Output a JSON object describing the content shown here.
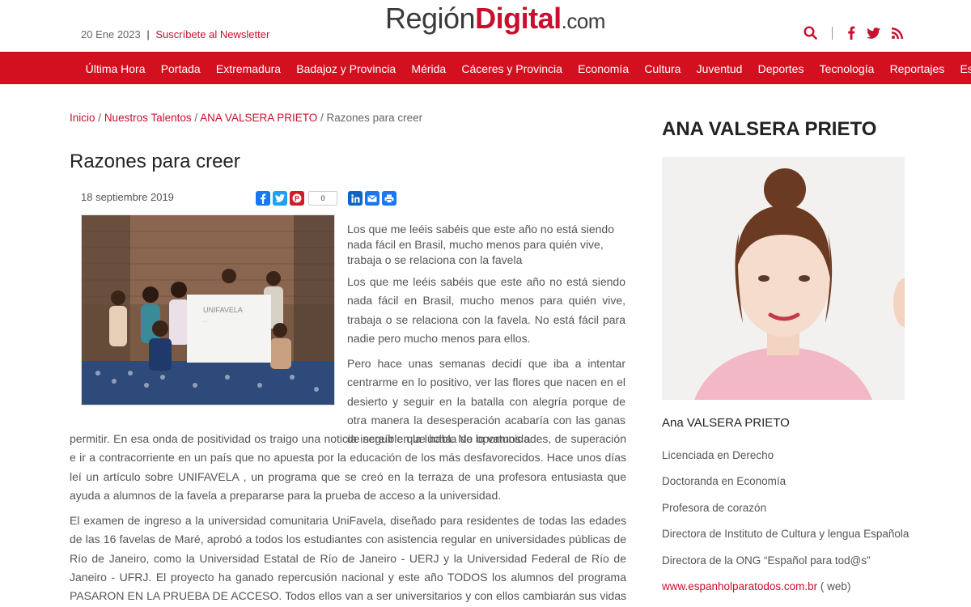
{
  "header": {
    "date": "20 Ene 2023",
    "separator": "|",
    "newsletter": "Suscríbete al Newsletter",
    "logo": {
      "part1": "Región",
      "part2": "Digital",
      "part3": ".com"
    },
    "icons": [
      "search-icon",
      "facebook-icon",
      "twitter-icon",
      "rss-icon"
    ],
    "brand_color": "#c8102e"
  },
  "nav": {
    "items": [
      "Última Hora",
      "Portada",
      "Extremadura",
      "Badajoz y Provincia",
      "Mérida",
      "Cáceres y Provincia",
      "Economía",
      "Cultura",
      "Juventud",
      "Deportes",
      "Tecnología",
      "Reportajes",
      "Especiales"
    ],
    "bg_color": "#d3101f"
  },
  "breadcrumb": {
    "home": "Inicio",
    "section": "Nuestros Talentos",
    "author": "ANA VALSERA PRIETO",
    "current": "Razones para creer",
    "sep": "/"
  },
  "article": {
    "title": "Razones para creer",
    "date": "18 septiembre 2019",
    "share_count": "0",
    "share_icons": [
      "facebook-share-icon",
      "twitter-share-icon",
      "pinterest-share-icon",
      "linkedin-share-icon",
      "email-share-icon",
      "print-share-icon"
    ],
    "lead": "Los que me leéis sabéis que este año no está siendo nada fácil en Brasil, mucho menos para quién vive, trabaja o se relaciona con la favela",
    "p1": "Los que me leéis sabéis que este año no está siendo nada fácil en Brasil, mucho menos para quién vive, trabaja o se relaciona con la favela. No está fácil para nadie pero mucho menos para ellos.",
    "p2a": "Pero hace unas semanas decidí que iba a intentar centrarme en lo positivo, ver las flores que nacen en el desierto y seguir en la batalla con alegría porque de otra manera la desesperación acabaría con las ganas de seguir en la lucha. No lo vamos a",
    "p2b": "permitir. En esa onda de positividad os traigo una noticia increíble que habla de oportunidades, de superación e ir a contracorriente en un país que no apuesta por la educación de los más desfavorecidos. Hace unos días leí un artículo sobre UNIFAVELA , un programa que se creó en la terraza de una profesora entusiasta que ayuda a alumnos de la favela a prepararse para la prueba de acceso a la universidad.",
    "p3": "El examen de ingreso a la universidad comunitaria UniFavela, diseñado para residentes de todas las edades de las 16 favelas de Maré, aprobó a todos los estudiantes con asistencia regular en universidades públicas de Río de Janeiro, como la Universidad Estatal de Río de Janeiro - UERJ y la Universidad Federal de Río de Janeiro - UFRJ. El proyecto ha ganado repercusión nacional y este año TODOS los alumnos del programa PASARON EN LA PRUEBA DE ACCESO. Todos ellos van a ser universitarios y con ellos cambiarán sus vidas para siempre."
  },
  "sidebar": {
    "title": "ANA VALSERA PRIETO",
    "name": "Ana VALSERA PRIETO",
    "bio": [
      "Licenciada en Derecho",
      "Doctoranda en Economía",
      "Profesora de corazón",
      "Directora de Instituto de Cultura y lengua Española",
      "Directora de la ONG “Español para tod@s”"
    ],
    "web_link": "www.espanholparatodos.com.br",
    "web_suffix": "( web)"
  }
}
